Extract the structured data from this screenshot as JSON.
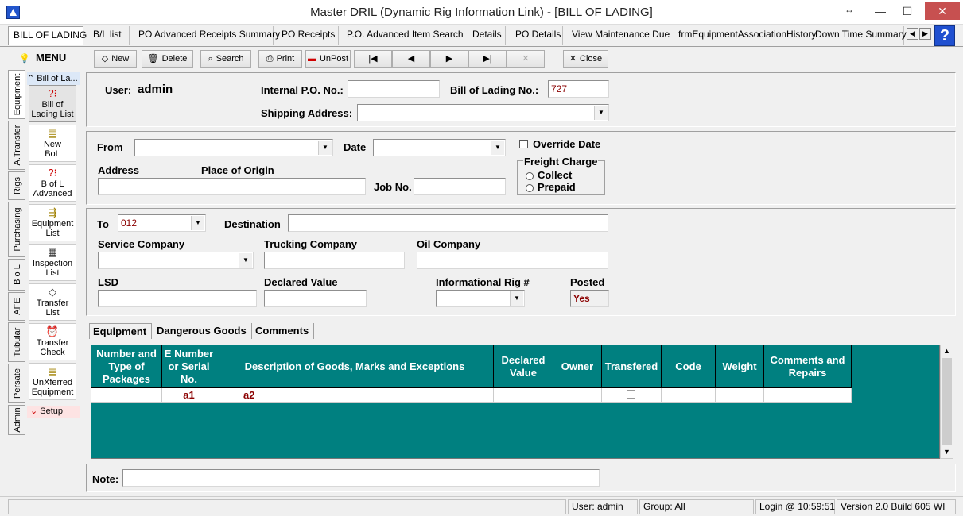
{
  "window": {
    "title": "Master DRIL (Dynamic Rig Information Link) - [BILL OF LADING]",
    "restore_glyph": "↔",
    "min_glyph": "—",
    "max_glyph": "☐",
    "close_glyph": "✕"
  },
  "tabs": [
    {
      "label": "BILL OF LADING",
      "active": true
    },
    {
      "label": "B/L list"
    },
    {
      "label": "PO Advanced Receipts Summary"
    },
    {
      "label": "PO Receipts"
    },
    {
      "label": "P.O. Advanced Item Search"
    },
    {
      "label": "Details"
    },
    {
      "label": "PO Details"
    },
    {
      "label": "View Maintenance Due"
    },
    {
      "label": "frmEquipmentAssociationHistory"
    },
    {
      "label": "Down Time Summary"
    }
  ],
  "tab_scroll": {
    "left": "◀",
    "right": "▶"
  },
  "help_label": "?",
  "menu": {
    "label": "MENU",
    "icon": "💡"
  },
  "toolbar": {
    "new": "New",
    "delete": "Delete",
    "search": "Search",
    "print": "Print",
    "unpost": "UnPost",
    "first": "|◀",
    "prev": "◀",
    "next": "▶",
    "last": "▶|",
    "cancel": "✕",
    "close": "Close",
    "new_icon": "◇",
    "delete_icon": "🗑",
    "search_icon": "⌕",
    "print_icon": "⎙",
    "unpost_icon": "▬",
    "close_icon": "✕"
  },
  "vertical_tabs": [
    {
      "label": "Equipment",
      "active": true
    },
    {
      "label": "A.Transfer"
    },
    {
      "label": "Rigs"
    },
    {
      "label": "Purchasing"
    },
    {
      "label": "B o L"
    },
    {
      "label": "AFE"
    },
    {
      "label": "Tubular"
    },
    {
      "label": "Persate"
    },
    {
      "label": "Admin"
    }
  ],
  "sidenav": {
    "header": "Bill of La...",
    "header_icon": "⌃",
    "items": [
      {
        "label1": "Bill of",
        "label2": "Lading List",
        "icon": "?⁝",
        "active": true
      },
      {
        "label1": "New",
        "label2": "BoL",
        "icon": "▤"
      },
      {
        "label1": "B of L",
        "label2": "Advanced",
        "icon": "?⁝"
      },
      {
        "label1": "Equipment",
        "label2": "List",
        "icon": "⇶"
      },
      {
        "label1": "Inspection",
        "label2": "List",
        "icon": "▦"
      },
      {
        "label1": "Transfer",
        "label2": "List",
        "icon": "◇"
      },
      {
        "label1": "Transfer",
        "label2": "Check",
        "icon": "⏰"
      },
      {
        "label1": "UnXferred",
        "label2": "Equipment",
        "icon": "▤"
      }
    ],
    "setup": "Setup",
    "setup_icon": "⌄"
  },
  "header_section": {
    "user_label": "User:",
    "user_value": "admin",
    "internal_po_label": "Internal P.O. No.:",
    "internal_po_value": "",
    "bol_no_label": "Bill of Lading No.:",
    "bol_no_value": "727",
    "shipping_address_label": "Shipping Address:",
    "shipping_address_value": ""
  },
  "from_section": {
    "from_label": "From",
    "from_value": "",
    "date_label": "Date",
    "date_value": "",
    "override_date_label": "Override Date",
    "override_date_checked": false,
    "address_label": "Address",
    "place_of_origin_label": "Place of Origin",
    "address_value": "",
    "job_no_label": "Job No.",
    "job_no_value": "",
    "freight_charge_label": "Freight Charge",
    "freight_options": [
      "Collect",
      "Prepaid"
    ],
    "freight_selected": null
  },
  "to_section": {
    "to_label": "To",
    "to_value": "012",
    "destination_label": "Destination",
    "destination_value": "",
    "service_company_label": "Service Company",
    "service_company_value": "",
    "trucking_company_label": "Trucking Company",
    "trucking_company_value": "",
    "oil_company_label": "Oil Company",
    "oil_company_value": "",
    "lsd_label": "LSD",
    "lsd_value": "",
    "declared_value_label": "Declared Value",
    "declared_value_value": "",
    "informational_rig_label": "Informational Rig #",
    "informational_rig_value": "",
    "posted_label": "Posted",
    "posted_value": "Yes"
  },
  "subtabs": [
    {
      "label": "Equipment",
      "active": true
    },
    {
      "label": "Dangerous Goods"
    },
    {
      "label": "Comments"
    }
  ],
  "grid": {
    "columns": [
      "Number and Type of Packages",
      "E Number or Serial No.",
      "Description of Goods, Marks and Exceptions",
      "Declared Value",
      "Owner",
      "Transfered",
      "Code",
      "Weight",
      "Comments and Repairs"
    ],
    "rows": [
      {
        "packages": "",
        "serial": "a1",
        "description": "a2",
        "declared_value": "",
        "owner": "",
        "transfered": false,
        "code": "",
        "weight": "",
        "comments": ""
      }
    ],
    "scroll_up": "▲",
    "scroll_down": "▼"
  },
  "note": {
    "label": "Note:",
    "value": ""
  },
  "status": {
    "user": "User: admin",
    "group": "Group: All",
    "login": "Login @ 10:59:51",
    "version": "Version 2.0 Build 605 WI"
  }
}
